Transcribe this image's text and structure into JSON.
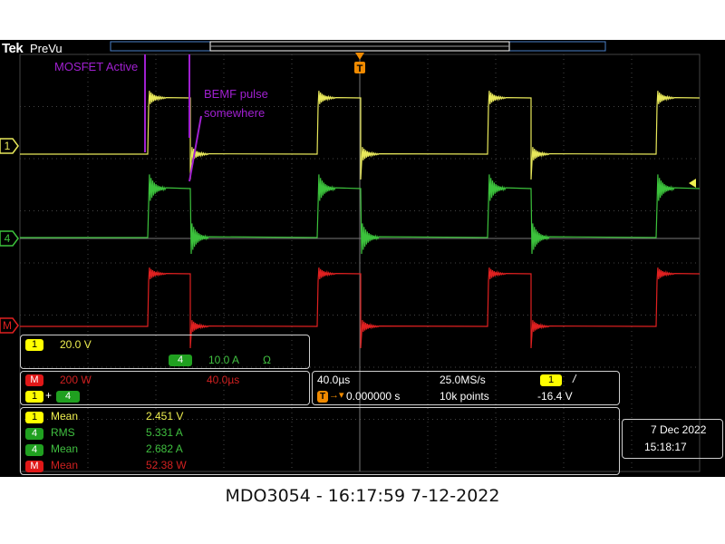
{
  "brand": "Tek",
  "status": "PreVu",
  "trigger_marker": "T",
  "channel_markers": {
    "ch1": "1",
    "ch4": "4",
    "math": "M"
  },
  "annotations": {
    "mosfet": "MOSFET Active",
    "bemf_line1": "BEMF pulse",
    "bemf_line2": "somewhere"
  },
  "channels": {
    "ch1": {
      "badge": "1",
      "scale": "20.0 V"
    },
    "ch4": {
      "badge": "4",
      "scale": "10.0 A",
      "termination": "Ω"
    }
  },
  "math": {
    "badge": "M",
    "scale": "200 W",
    "timebase": "40.0µs",
    "src_a": "1",
    "src_b": "4"
  },
  "horizontal": {
    "scale": "40.0µs",
    "sample_rate": "25.0MS/s",
    "trigger_position": "0.000000 s",
    "record_length": "10k points",
    "trigger_source": "1",
    "trigger_slope": "/",
    "trigger_level": "-16.4 V"
  },
  "measurements": [
    {
      "src": "1",
      "name": "Mean",
      "value": "2.451 V",
      "color": "#f0f050",
      "badge_class": "y"
    },
    {
      "src": "4",
      "name": "RMS",
      "value": "5.331 A",
      "color": "#40c040",
      "badge_class": "g"
    },
    {
      "src": "4",
      "name": "Mean",
      "value": "2.682 A",
      "color": "#40c040",
      "badge_class": "g"
    },
    {
      "src": "M",
      "name": "Mean",
      "value": "52.38 W",
      "color": "#d02020",
      "badge_class": "r"
    }
  ],
  "datetime": {
    "date": "7 Dec  2022",
    "time": "15:18:17"
  },
  "caption": "MDO3054 - 16:17:59   7-12-2022",
  "trace_colors": {
    "ch1": "#e8e85a",
    "ch4": "#3cc23c",
    "math": "#e02020",
    "annotation": "#a020d0",
    "grid": "#444444"
  }
}
